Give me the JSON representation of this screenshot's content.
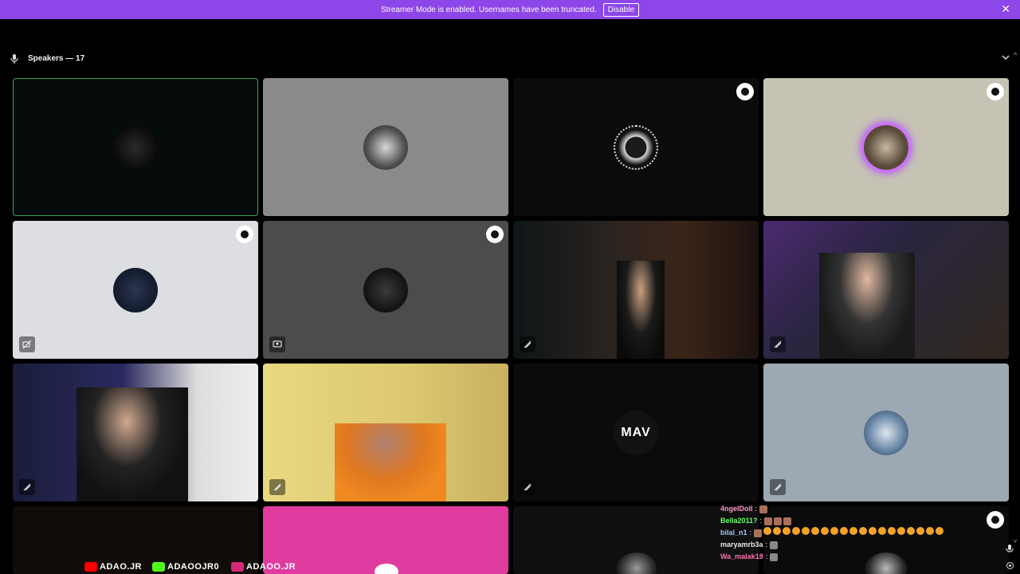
{
  "banner": {
    "message": "Streamer Mode is enabled. Usernames have been truncated.",
    "disable_label": "Disable",
    "close_icon": "close-icon",
    "color": "#8d46e8"
  },
  "speakers": {
    "label": "Speakers — 17"
  },
  "tiles": [
    {
      "bg": "#060b0b",
      "active": true
    },
    {
      "bg": "#8a8a8a"
    },
    {
      "bg": "#0b0b0b",
      "badge": true
    },
    {
      "bg": "#c6c3b4",
      "badge": true
    },
    {
      "bg": "#dcdee2",
      "badge": true
    },
    {
      "bg": "#4c4c4c",
      "badge": true
    },
    {
      "bg": "#1c1a19"
    },
    {
      "bg": "#2c2140"
    },
    {
      "bg": "#27243a"
    },
    {
      "bg": "#e6d27a"
    },
    {
      "bg": "#0b0b0b"
    },
    {
      "bg": "#9ca8b2"
    },
    {
      "bg": "#120c0b"
    },
    {
      "bg": "#e03ca0"
    },
    {
      "bg": "#101010"
    },
    {
      "bg": "#0b0b0b",
      "badge": true
    }
  ],
  "chat": [
    {
      "user": "4ngelDoll",
      "color": "#ff8fbf",
      "emotes": 1
    },
    {
      "user": "Bella2011?",
      "color": "#6dff6d",
      "emotes": 3
    },
    {
      "user": "bilal_n1",
      "color": "#9ec1ff",
      "emotes": 20,
      "round": true
    },
    {
      "user": "maryamrb3a",
      "color": "#e8e8e8",
      "emotes": 1
    },
    {
      "user": "Wa_malak18",
      "color": "#ff6fb0",
      "emotes": 1
    }
  ],
  "socials": [
    {
      "text": "ADAO.JR",
      "color": "#ff0000"
    },
    {
      "text": "ADAOOJR0",
      "color": "#53fc18"
    },
    {
      "text": "ADAOO.JR",
      "color": "#d62976"
    }
  ],
  "nameplates": {
    "tile_11": "MAV"
  }
}
